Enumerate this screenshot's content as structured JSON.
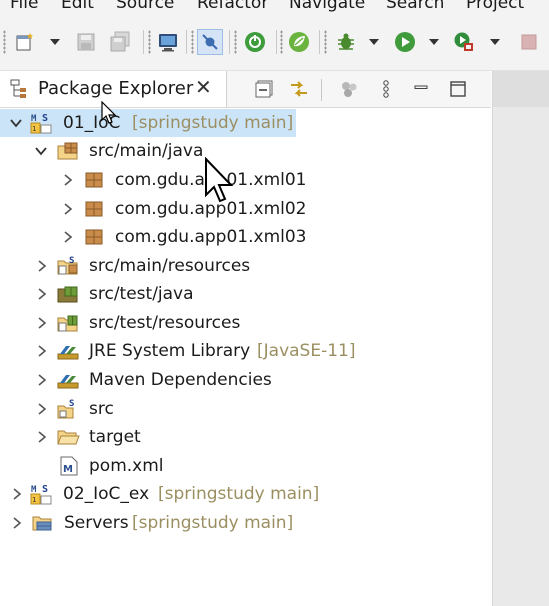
{
  "menu": [
    "File",
    "Edit",
    "Source",
    "Refactor",
    "Navigate",
    "Search",
    "Project"
  ],
  "toolbar": {
    "new": "new-wizard-icon",
    "save": "save-icon",
    "save_all": "save-all-icon",
    "terminal": "terminal-icon",
    "skip_breakpoints": "skip-breakpoints-icon",
    "spring_boot": "spring-boot-dashboard-icon",
    "spring": "spring-icon",
    "debug": "debug-icon",
    "run": "run-icon",
    "run_external": "external-tools-icon",
    "stop": "stop-icon"
  },
  "view": {
    "title": "Package Explorer",
    "close_glyph": "✕",
    "actions": [
      "collapse-all-icon",
      "link-with-editor-icon",
      "focus-icon",
      "view-menu-icon",
      "minimize-icon",
      "maximize-icon"
    ]
  },
  "tree": [
    {
      "label": "01_IoC",
      "decoration": "[springstudy main]",
      "icon": "maven-project-icon",
      "expanded": true,
      "selected": true
    },
    {
      "label": "src/main/java",
      "decoration": "",
      "icon": "source-folder-icon",
      "expanded": true
    },
    {
      "label": "com.gdu.app01.xml01",
      "decoration": "",
      "icon": "package-icon",
      "expanded": false
    },
    {
      "label": "com.gdu.app01.xml02",
      "decoration": "",
      "icon": "package-icon",
      "expanded": false
    },
    {
      "label": "com.gdu.app01.xml03",
      "decoration": "",
      "icon": "package-icon",
      "expanded": false
    },
    {
      "label": "src/main/resources",
      "decoration": "",
      "icon": "resource-folder-icon",
      "expanded": false
    },
    {
      "label": "src/test/java",
      "decoration": "",
      "icon": "test-source-folder-icon",
      "expanded": false
    },
    {
      "label": "src/test/resources",
      "decoration": "",
      "icon": "test-resource-folder-icon",
      "expanded": false
    },
    {
      "label": "JRE System Library",
      "decoration": "[JavaSE-11]",
      "icon": "library-icon",
      "expanded": false
    },
    {
      "label": "Maven Dependencies",
      "decoration": "",
      "icon": "library-icon",
      "expanded": false
    },
    {
      "label": "src",
      "decoration": "",
      "icon": "folder-icon",
      "expanded": false
    },
    {
      "label": "target",
      "decoration": "",
      "icon": "folder-icon",
      "expanded": false
    },
    {
      "label": "pom.xml",
      "decoration": "",
      "icon": "maven-pom-icon",
      "expanded": null
    },
    {
      "label": "02_IoC_ex",
      "decoration": "[springstudy main]",
      "icon": "maven-project-icon",
      "expanded": false
    },
    {
      "label": "Servers",
      "decoration": "[springstudy main]",
      "icon": "servers-project-icon",
      "expanded": false
    }
  ],
  "colors": {
    "selection": "#cce4f7",
    "decoration": "#9b8f62",
    "package": "#b5783a"
  }
}
